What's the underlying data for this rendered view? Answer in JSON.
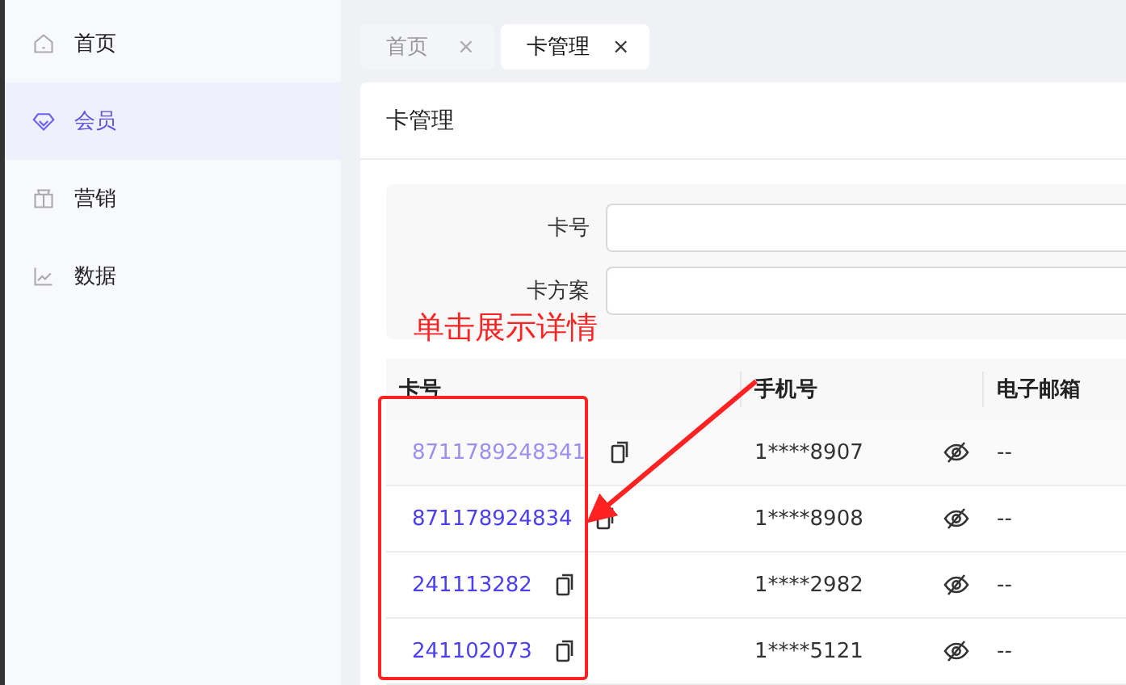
{
  "sidebar": {
    "items": [
      {
        "label": "首页",
        "selected": false
      },
      {
        "label": "会员",
        "selected": true
      },
      {
        "label": "营销",
        "selected": false
      },
      {
        "label": "数据",
        "selected": false
      }
    ]
  },
  "tabs": [
    {
      "label": "首页",
      "close": "×",
      "selected": false
    },
    {
      "label": "卡管理",
      "close": "×",
      "selected": true
    }
  ],
  "card": {
    "title": "卡管理"
  },
  "filters": [
    {
      "label": "卡号"
    },
    {
      "label": "卡方案"
    }
  ],
  "annotation": {
    "text": "单击展示详情"
  },
  "table": {
    "columns": [
      "卡号",
      "手机号",
      "电子邮箱"
    ],
    "rows": [
      {
        "card_no": "8711789248341",
        "hovered": true,
        "phone": "1****8907",
        "email": "--"
      },
      {
        "card_no": "871178924834",
        "hovered": false,
        "phone": "1****8908",
        "email": "--"
      },
      {
        "card_no": "241113282",
        "hovered": false,
        "phone": "1****2982",
        "email": "--"
      },
      {
        "card_no": "241102073",
        "hovered": false,
        "phone": "1****5121",
        "email": "--"
      }
    ]
  }
}
